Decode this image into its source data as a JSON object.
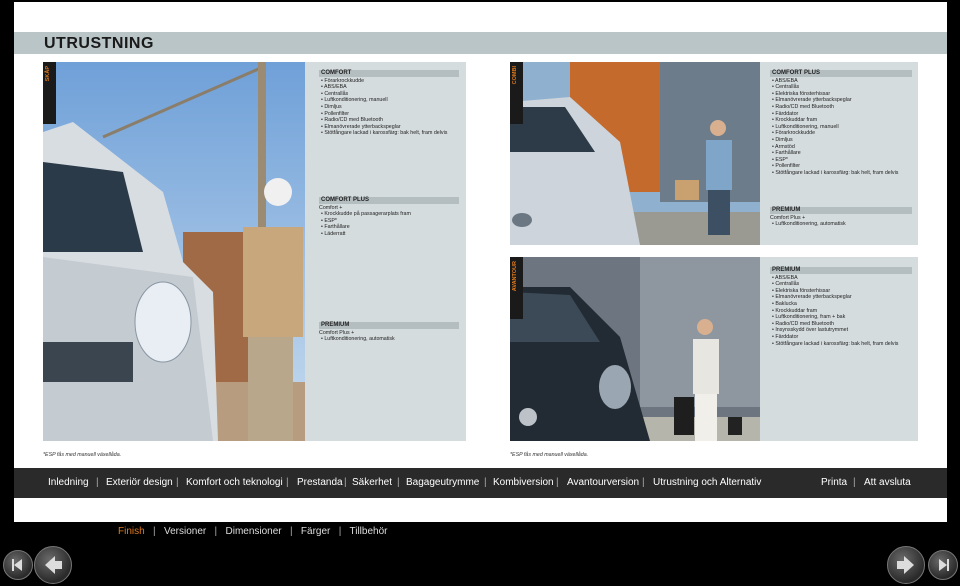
{
  "page_title": "UTRUSTNING",
  "panels": {
    "skap": {
      "tag": "SKÅP",
      "blocks": [
        {
          "heading": "COMFORT",
          "items": [
            "Förarkrockkudde",
            "ABS/EBA",
            "Centrallås",
            "Luftkonditionering, manuell",
            "Dimljus",
            "Pollenfilter",
            "Radio/CD med Bluetooth",
            "Elmanövrerade ytterbackspeglar",
            "Stötfångare lackad i karossfärg: bak helt, fram delvis"
          ]
        },
        {
          "heading": "COMFORT PLUS",
          "intro": "Comfort +",
          "items": [
            "Krockkudde på passagerarplats fram",
            "ESP*",
            "Farthållare",
            "Läderratt"
          ]
        },
        {
          "heading": "PREMIUM",
          "intro": "Comfort Plus +",
          "items": [
            "Luftkonditionering, automatisk"
          ]
        }
      ],
      "footnote": "*ESP fås med manuell växellåda."
    },
    "combi": {
      "tag": "COMBI",
      "blocks": [
        {
          "heading": "COMFORT PLUS",
          "items": [
            "ABS/EBA",
            "Centrallås",
            "Elektriska fönsterhissar",
            "Elmanövrerade ytterbackspeglar",
            "Radio/CD med Bluetooth",
            "Färddator",
            "Krockkuddar fram",
            "Luftkonditionering, manuell",
            "Förarkrockkudde",
            "Dimljus",
            "Armstöd",
            "Farthållare",
            "ESP*",
            "Pollenfilter",
            "Stötfångare lackad i karossfärg: bak helt, fram delvis"
          ]
        },
        {
          "heading": "PREMIUM",
          "intro": "Comfort Plus +",
          "items": [
            "Luftkonditionering, automatisk"
          ]
        }
      ]
    },
    "avantour": {
      "tag": "AVANTOUR",
      "blocks": [
        {
          "heading": "PREMIUM",
          "items": [
            "ABS/EBA",
            "Centrallås",
            "Elektriska fönsterhissar",
            "Elmanövrerade ytterbackspeglar",
            "Baklucka",
            "Krockkuddar fram",
            "Luftkonditionering, fram + bak",
            "Radio/CD med Bluetooth",
            "Insynsskydd över lastutrymmet",
            "Färddator",
            "Stötfångare lackad i karossfärg: bak helt, fram delvis"
          ]
        }
      ],
      "footnote": "*ESP fås med manuell växellåda."
    }
  },
  "nav": {
    "items": [
      "Inledning",
      "Exteriör design",
      "Komfort och teknologi",
      "Prestanda",
      "Säkerhet",
      "Bagageutrymme",
      "Kombiversion",
      "Avantourversion",
      "Utrustning och Alternativ"
    ],
    "right": [
      "Printa",
      "Att avsluta"
    ]
  },
  "subnav": {
    "items": [
      "Finish",
      "Versioner",
      "Dimensioner",
      "Färger",
      "Tillbehör"
    ],
    "active": "Finish"
  },
  "icons": {
    "back": "double-left-arrow-icon",
    "prev": "left-arrow-icon",
    "next": "right-arrow-icon",
    "forward": "double-right-arrow-icon"
  },
  "colors": {
    "accent": "#e07a1c",
    "title_bar": "#b9c5c7",
    "nav_bg": "#2a2a2a",
    "panel_bg": "#d5dcde"
  }
}
